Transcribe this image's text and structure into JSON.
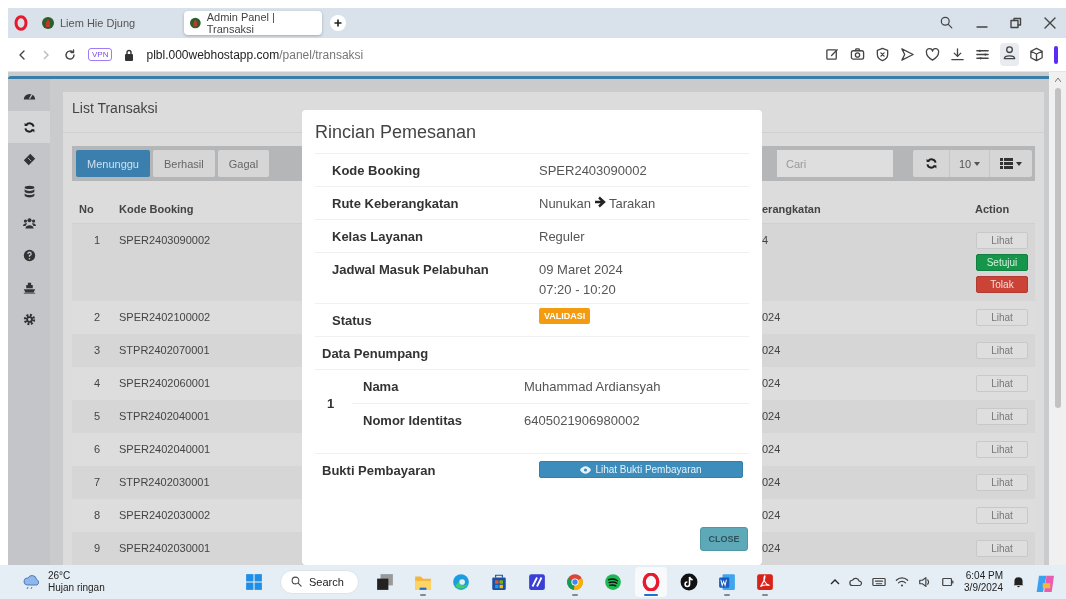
{
  "browser": {
    "tabs": [
      {
        "title": "Liem Hie Djung",
        "selected": false
      },
      {
        "title": "Admin Panel | Transaksi",
        "selected": true
      }
    ],
    "vpn": "VPN",
    "url": {
      "host": "plbl.000webhostapp.com",
      "path": "/panel/transaksi"
    }
  },
  "sidebar": {
    "items": [
      {
        "kind": "gauge",
        "selected": false
      },
      {
        "kind": "refresh",
        "selected": true
      },
      {
        "kind": "ticket",
        "selected": false
      },
      {
        "kind": "database",
        "selected": false
      },
      {
        "kind": "users",
        "selected": false
      },
      {
        "kind": "question",
        "selected": false
      },
      {
        "kind": "ship",
        "selected": false
      },
      {
        "kind": "gear",
        "selected": false
      }
    ]
  },
  "panel": {
    "title": "List Transaksi",
    "filters": [
      {
        "label": "Menunggu",
        "selected": true
      },
      {
        "label": "Berhasil",
        "selected": false
      },
      {
        "label": "Gagal",
        "selected": false
      }
    ],
    "search": {
      "placeholder": "Cari"
    },
    "page_size": "10"
  },
  "table": {
    "columns": [
      "No",
      "Kode Booking",
      "erangkatan",
      "Action"
    ],
    "rows": [
      {
        "no": "1",
        "kode_booking": "SPER2403090002",
        "column_3": "4",
        "actions": [
          {
            "label": "Lihat",
            "kind": "default"
          },
          {
            "label": "Setujui",
            "kind": "success"
          },
          {
            "label": "Tolak",
            "kind": "danger"
          }
        ]
      },
      {
        "no": "2",
        "kode_booking": "SPER2402100002",
        "column_3": "024",
        "actions": [
          {
            "label": "Lihat",
            "kind": "default"
          }
        ]
      },
      {
        "no": "3",
        "kode_booking": "STPR2402070001",
        "column_3": "024",
        "actions": [
          {
            "label": "Lihat",
            "kind": "default"
          }
        ]
      },
      {
        "no": "4",
        "kode_booking": "SPER2402060001",
        "column_3": "024",
        "actions": [
          {
            "label": "Lihat",
            "kind": "default"
          }
        ]
      },
      {
        "no": "5",
        "kode_booking": "STPR2402040001",
        "column_3": "024",
        "actions": [
          {
            "label": "Lihat",
            "kind": "default"
          }
        ]
      },
      {
        "no": "6",
        "kode_booking": "SPER2402040001",
        "column_3": "024",
        "actions": [
          {
            "label": "Lihat",
            "kind": "default"
          }
        ]
      },
      {
        "no": "7",
        "kode_booking": "STPR2402030001",
        "column_3": "024",
        "actions": [
          {
            "label": "Lihat",
            "kind": "default"
          }
        ]
      },
      {
        "no": "8",
        "kode_booking": "SPER2402030002",
        "column_3": "024",
        "actions": [
          {
            "label": "Lihat",
            "kind": "default"
          }
        ]
      },
      {
        "no": "9",
        "kode_booking": "SPER2402030001",
        "column_3": "024",
        "actions": [
          {
            "label": "Lihat",
            "kind": "default"
          }
        ]
      }
    ]
  },
  "modal": {
    "title": "Rincian Pemesanan",
    "details": [
      {
        "kind": "text",
        "label": "Kode Booking",
        "value": "SPER2403090002"
      },
      {
        "kind": "route",
        "label": "Rute Keberangkatan",
        "from": "Nunukan",
        "to": "Tarakan"
      },
      {
        "kind": "text",
        "label": "Kelas Layanan",
        "value": "Reguler"
      },
      {
        "kind": "lines",
        "label": "Jadwal Masuk Pelabuhan",
        "lines": [
          "09 Maret 2024",
          "07:20 - 10:20"
        ]
      },
      {
        "kind": "badge",
        "label": "Status",
        "value": "VALIDASI"
      }
    ],
    "passengers_title": "Data Penumpang",
    "passengers": [
      {
        "no": "1",
        "fields": [
          {
            "label": "Nama",
            "value": "Muhammad Ardiansyah"
          },
          {
            "label": "Nomor Identitas",
            "value": "6405021906980002"
          }
        ]
      }
    ],
    "payment": {
      "label": "Bukti Pembayaran",
      "button": "Lihat Bukti Pembayaran"
    },
    "close": "CLOSE"
  },
  "taskbar": {
    "weather": {
      "temp": "26°C",
      "description": "Hujan ringan"
    },
    "search": "Search",
    "apps": [
      {
        "kind": "start",
        "selected": false,
        "running": false
      },
      {
        "kind": "taskview",
        "selected": false,
        "running": false
      },
      {
        "kind": "folder",
        "selected": false,
        "running": true
      },
      {
        "kind": "edge",
        "selected": false,
        "running": false
      },
      {
        "kind": "store",
        "selected": false,
        "running": false
      },
      {
        "kind": "tile",
        "selected": false,
        "running": false
      },
      {
        "kind": "chrome",
        "selected": false,
        "running": true
      },
      {
        "kind": "spotify",
        "selected": false,
        "running": false
      },
      {
        "kind": "opera",
        "selected": true,
        "running": true
      },
      {
        "kind": "tiktok",
        "selected": false,
        "running": false
      },
      {
        "kind": "word",
        "selected": false,
        "running": true
      },
      {
        "kind": "acrobat",
        "selected": false,
        "running": true
      }
    ],
    "time": "6:04 PM",
    "date": "3/9/2024"
  }
}
